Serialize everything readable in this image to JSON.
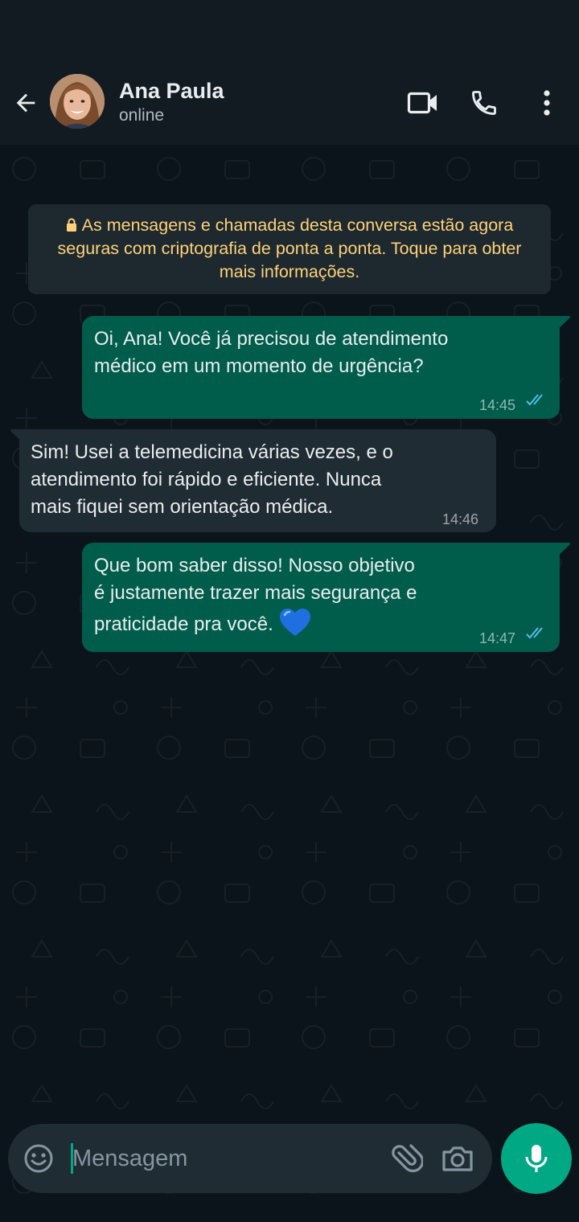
{
  "contact": {
    "name": "Ana Paula",
    "status": "online"
  },
  "encryption_notice": "As mensagens e chamadas desta conversa estão agora seguras com criptografia de ponta a ponta. Toque para obter mais informações.",
  "messages": [
    {
      "direction": "outgoing",
      "lines": [
        "Oi, Ana! Você já precisou de atendimento",
        "médico em um momento de urgência?"
      ],
      "time": "14:45",
      "read": true
    },
    {
      "direction": "incoming",
      "lines": [
        "Sim! Usei a telemedicina várias vezes, e o",
        "atendimento foi rápido e eficiente. Nunca",
        "mais fiquei sem orientação médica."
      ],
      "time": "14:46"
    },
    {
      "direction": "outgoing",
      "lines": [
        "Que bom saber disso! Nosso objetivo",
        "é justamente trazer mais segurança e",
        "praticidade pra você."
      ],
      "emoji": "blue-heart",
      "time": "14:47",
      "read": true
    }
  ],
  "composer": {
    "placeholder": "Mensagem"
  },
  "icons": {
    "back": "arrow-left-icon",
    "video": "video-camera-icon",
    "call": "phone-icon",
    "menu": "more-vertical-icon",
    "emoji": "smiley-icon",
    "attach": "paperclip-icon",
    "camera": "camera-icon",
    "mic": "microphone-icon"
  },
  "colors": {
    "app_bar": "#121b22",
    "background": "#0b141a",
    "outgoing_bubble": "#005c4b",
    "incoming_bubble": "#202c33",
    "notice_text": "#ffd279",
    "accent": "#00a884",
    "read_ticks": "#53bdeb"
  }
}
